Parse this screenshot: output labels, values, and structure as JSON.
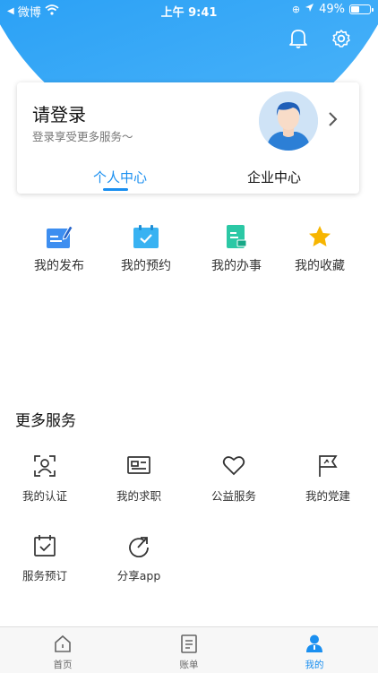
{
  "status_bar": {
    "carrier": "微博",
    "time": "上午 9:41",
    "battery_percent": "49%",
    "battery_level": 0.49
  },
  "header": {
    "bell_icon": "bell-icon",
    "settings_icon": "gear-icon"
  },
  "login_card": {
    "title": "请登录",
    "subtitle": "登录享受更多服务～",
    "tabs": [
      {
        "label": "个人中心",
        "active": true
      },
      {
        "label": "企业中心",
        "active": false
      }
    ]
  },
  "quick_actions": [
    {
      "label": "我的发布",
      "icon": "edit-note-icon",
      "color": "#3d8ef0"
    },
    {
      "label": "我的预约",
      "icon": "calendar-check-icon",
      "color": "#38b2f2"
    },
    {
      "label": "我的办事",
      "icon": "document-icon",
      "color": "#2bc8a5"
    },
    {
      "label": "我的收藏",
      "icon": "star-icon",
      "color": "#f7b500"
    }
  ],
  "more_services": {
    "title": "更多服务",
    "items": [
      {
        "label": "我的认证",
        "icon": "id-scan-icon"
      },
      {
        "label": "我的求职",
        "icon": "resume-card-icon"
      },
      {
        "label": "公益服务",
        "icon": "heart-icon"
      },
      {
        "label": "我的党建",
        "icon": "flag-icon"
      },
      {
        "label": "服务预订",
        "icon": "calendar-check-icon"
      },
      {
        "label": "分享app",
        "icon": "share-arrow-icon"
      }
    ]
  },
  "bottom_nav": [
    {
      "label": "首页",
      "icon": "home-icon",
      "active": false
    },
    {
      "label": "账单",
      "icon": "bill-icon",
      "active": false
    },
    {
      "label": "我的",
      "icon": "user-icon",
      "active": true
    }
  ],
  "colors": {
    "primary": "#1a8ff0",
    "header_gradient_end": "#4fb6fa"
  }
}
